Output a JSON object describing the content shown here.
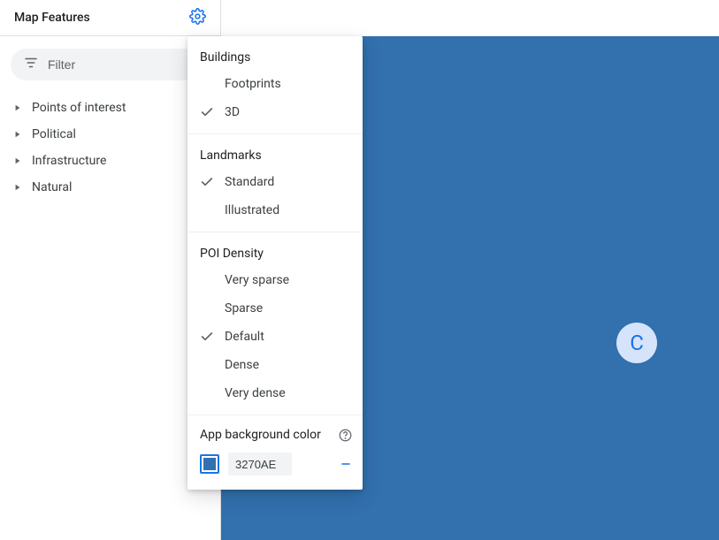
{
  "panel": {
    "title": "Map Features",
    "filter_placeholder": "Filter"
  },
  "tree": {
    "items": [
      {
        "label": "Points of interest"
      },
      {
        "label": "Political"
      },
      {
        "label": "Infrastructure"
      },
      {
        "label": "Natural"
      }
    ]
  },
  "settings": {
    "buildings": {
      "heading": "Buildings",
      "options": [
        {
          "label": "Footprints",
          "checked": false
        },
        {
          "label": "3D",
          "checked": true
        }
      ]
    },
    "landmarks": {
      "heading": "Landmarks",
      "options": [
        {
          "label": "Standard",
          "checked": true
        },
        {
          "label": "Illustrated",
          "checked": false
        }
      ]
    },
    "poi_density": {
      "heading": "POI Density",
      "options": [
        {
          "label": "Very sparse",
          "checked": false
        },
        {
          "label": "Sparse",
          "checked": false
        },
        {
          "label": "Default",
          "checked": true
        },
        {
          "label": "Dense",
          "checked": false
        },
        {
          "label": "Very dense",
          "checked": false
        }
      ]
    },
    "app_bg": {
      "heading": "App background color",
      "hex": "3270AE"
    }
  },
  "map": {
    "bg_color": "#3270AE"
  },
  "avatar": {
    "initial": "C"
  }
}
